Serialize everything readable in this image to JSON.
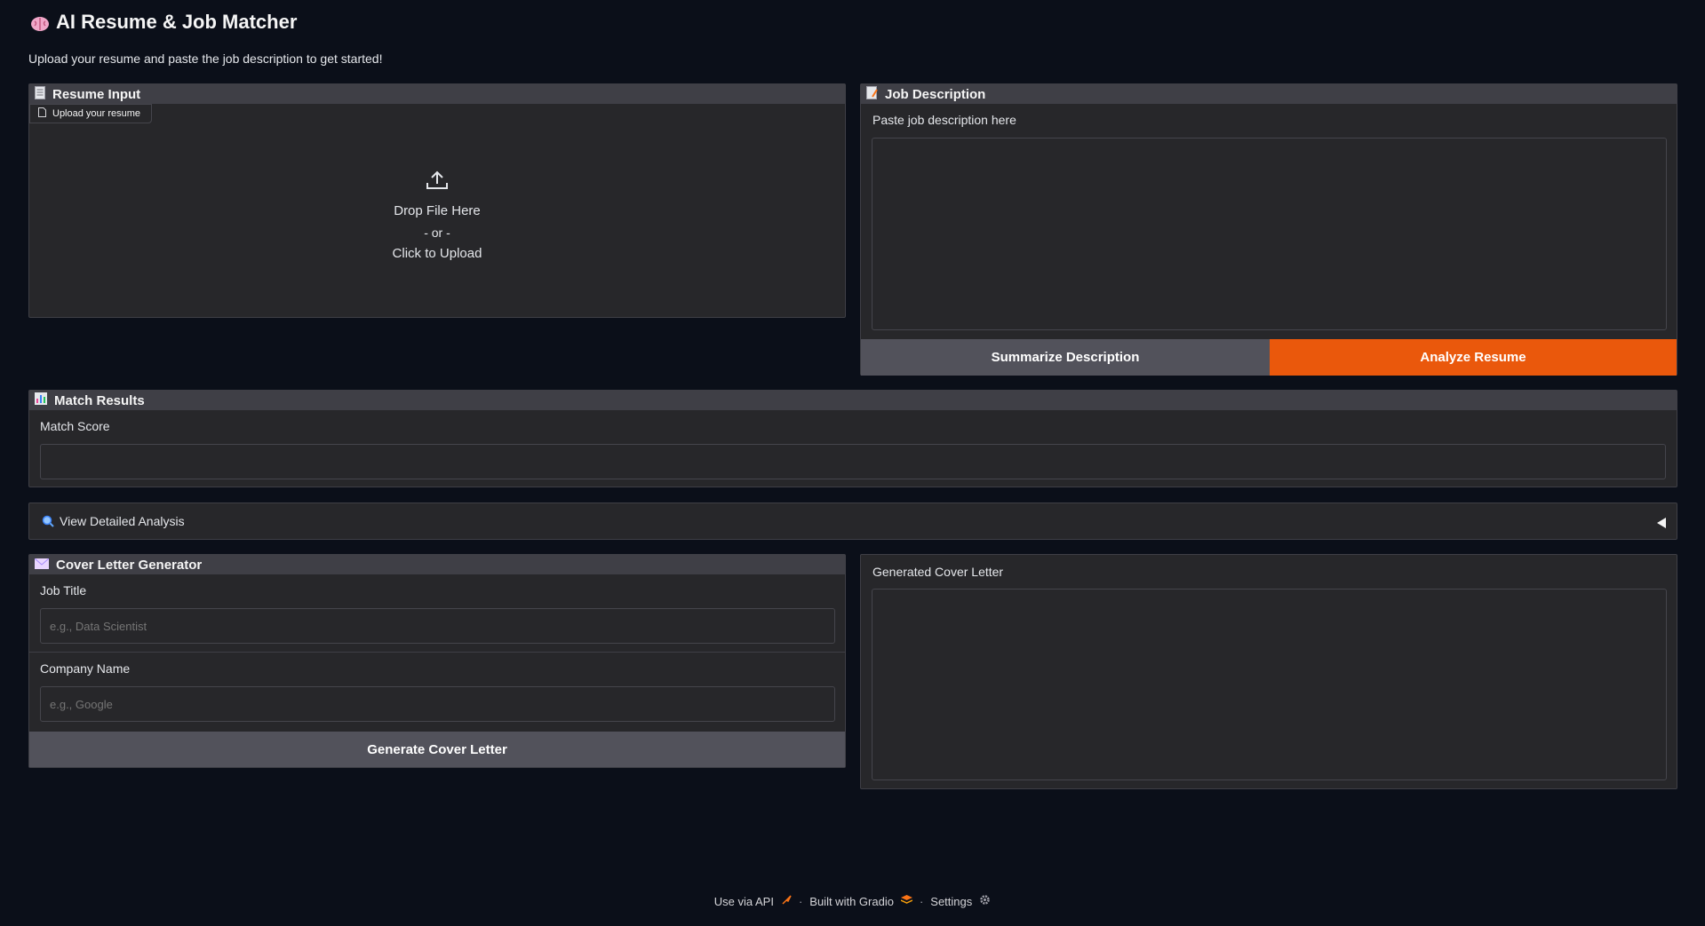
{
  "app": {
    "title": "AI Resume & Job Matcher",
    "title_icon": "brain-icon",
    "subtitle": "Upload your resume and paste the job description to get started!"
  },
  "resume_input": {
    "header": "Resume Input",
    "header_icon": "document-icon",
    "upload_chip": "Upload your resume",
    "drop_text": "Drop File Here",
    "or_text": "- or -",
    "click_text": "Click to Upload"
  },
  "job_description": {
    "header": "Job Description",
    "header_icon": "memo-icon",
    "label": "Paste job description here",
    "value": "",
    "summarize_button": "Summarize Description",
    "analyze_button": "Analyze Resume"
  },
  "match_results": {
    "header": "Match Results",
    "header_icon": "bar-chart-icon",
    "score_label": "Match Score",
    "score_value": ""
  },
  "detailed_analysis": {
    "label": "View Detailed Analysis",
    "icon": "magnifier-icon",
    "toggle_icon": "triangle-left-icon"
  },
  "cover_letter": {
    "header": "Cover Letter Generator",
    "header_icon": "envelope-icon",
    "job_title_label": "Job Title",
    "job_title_placeholder": "e.g., Data Scientist",
    "company_label": "Company Name",
    "company_placeholder": "e.g., Google",
    "generate_button": "Generate Cover Letter",
    "output_label": "Generated Cover Letter",
    "output_value": ""
  },
  "footer": {
    "api_link": "Use via API",
    "built_with": "Built with Gradio",
    "settings": "Settings",
    "separator": "·"
  },
  "colors": {
    "background": "#0b0f19",
    "panel": "#27272a",
    "header": "#3f3f46",
    "primary": "#ea580c",
    "secondary": "#52525b"
  }
}
